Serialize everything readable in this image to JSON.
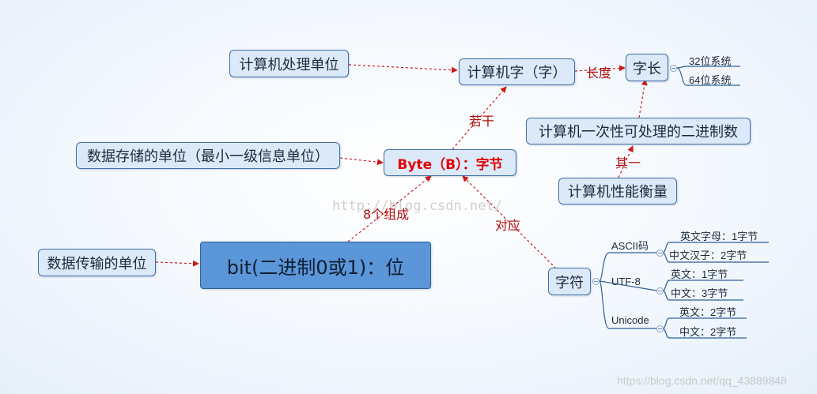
{
  "nodes": {
    "computer_processing_unit": "计算机处理单位",
    "computer_word": "计算机字（字）",
    "word_length": "字长",
    "bits_32": "32位系统",
    "bits_64": "64位系统",
    "binary_once": "计算机一次性可处理的二进制数",
    "performance": "计算机性能衡量",
    "storage_unit": "数据存储的单位（最小一级信息单位）",
    "byte": "Byte（B）：字节",
    "transmission_unit": "数据传输的单位",
    "bit": "bit(二进制0或1)：位",
    "character": "字符",
    "ascii": "ASCII码",
    "ascii_en": "英文字母：1字节",
    "ascii_zh": "中文汉子：2字节",
    "utf8": "UTF-8",
    "utf8_en": "英文：1字节",
    "utf8_zh": "中文：3字节",
    "unicode": "Unicode",
    "unicode_en": "英文：2字节",
    "unicode_zh": "中文：2字节"
  },
  "labels": {
    "length": "长度",
    "several": "若干",
    "one_of": "其一",
    "eight_make": "8个组成",
    "corresponds": "对应"
  },
  "watermarks": {
    "center": "http://blog.csdn.net/",
    "bottom": "https://blog.csdn.net/qq_43889848"
  },
  "colors": {
    "node_fill": "#dce9f8",
    "node_border": "#3f6fa8",
    "bit_fill": "#5b96d8",
    "relation_line": "#cc1b1b",
    "byte_text": "#e00000",
    "tree_line": "#2f5f9a"
  }
}
